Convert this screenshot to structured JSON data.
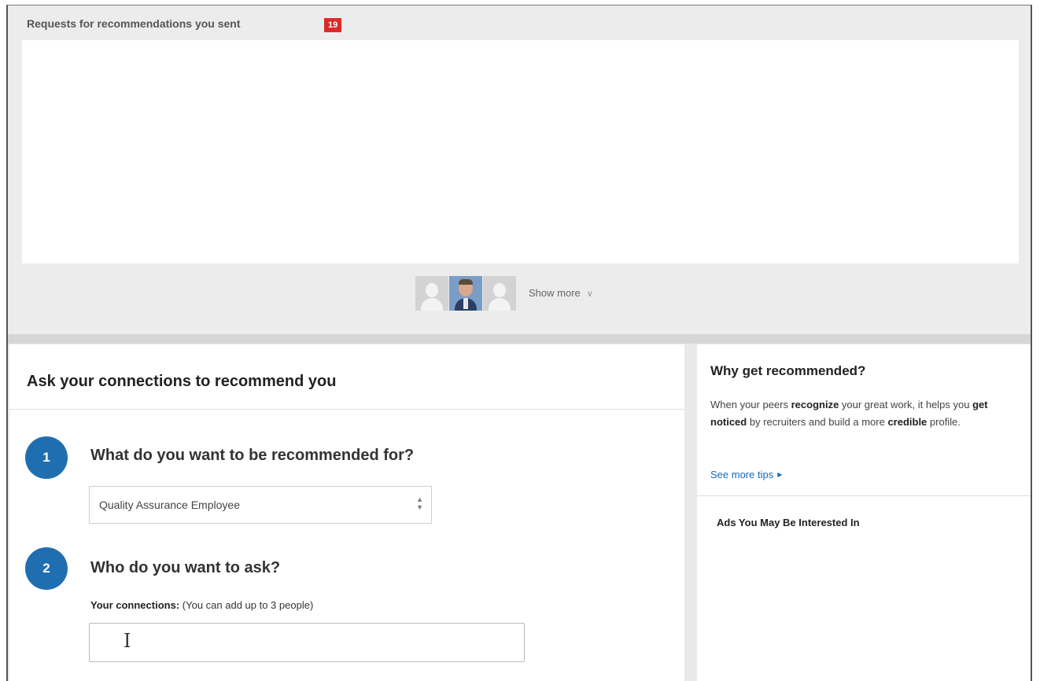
{
  "requests": {
    "title": "Requests for recommendations you sent",
    "count": "19",
    "show_more_label": "Show more",
    "avatars": [
      {
        "type": "placeholder",
        "icon": "person-silhouette-icon"
      },
      {
        "type": "photo",
        "icon": "person-photo-icon"
      },
      {
        "type": "placeholder",
        "icon": "person-silhouette-icon"
      }
    ]
  },
  "ask": {
    "title": "Ask your connections to recommend you",
    "step1": {
      "number": "1",
      "question": "What do you want to be recommended for?",
      "selected_position": "Quality Assurance Employee"
    },
    "step2": {
      "number": "2",
      "question": "Who do you want to ask?",
      "connections_label": "Your connections:",
      "connections_hint": "(You can add up to 3 people)",
      "input_value": ""
    }
  },
  "sidebar": {
    "title": "Why get recommended?",
    "text_parts": [
      "When your peers ",
      "recognize",
      " your great work, it helps you ",
      "get noticed",
      " by recruiters and build a more ",
      "credible",
      " profile."
    ],
    "tips_link": "See more tips",
    "ads_title": "Ads You May Be Interested In"
  },
  "colors": {
    "badge": "#dd2a2a",
    "step_circle": "#1f6fb0",
    "link": "#1a69b6"
  }
}
